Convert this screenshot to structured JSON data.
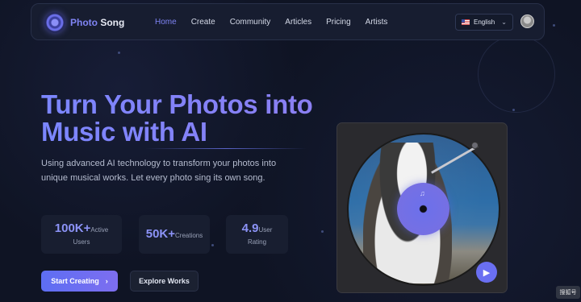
{
  "nav": {
    "logo_word_1": "Photo",
    "logo_word_2": "Song",
    "links": [
      {
        "label": "Home",
        "active": true
      },
      {
        "label": "Create"
      },
      {
        "label": "Community"
      },
      {
        "label": "Articles"
      },
      {
        "label": "Pricing"
      },
      {
        "label": "Artists"
      }
    ],
    "language": "English",
    "language_flag": "us-flag-icon"
  },
  "hero": {
    "title": "Turn Your Photos into Music with AI",
    "description": "Using advanced AI technology to transform your photos into unique musical works. Let every photo sing its own song."
  },
  "stats": [
    {
      "value": "100K+",
      "label_a": "Active",
      "label_b": "Users"
    },
    {
      "value": "50K+",
      "label_a": "Creations",
      "label_b": ""
    },
    {
      "value": "4.9",
      "label_a": "User",
      "label_b": "Rating"
    }
  ],
  "buttons": {
    "primary": "Start Creating",
    "primary_icon": "chevron-right-icon",
    "secondary": "Explore Works"
  },
  "player": {
    "play_icon": "play-icon",
    "artwork": "husky dog photo on vinyl record"
  },
  "corner_tag": "搜狐号",
  "colors": {
    "accent": "#7f84f4",
    "background": "#0f1424",
    "primary_button": "#5d6ef3"
  }
}
